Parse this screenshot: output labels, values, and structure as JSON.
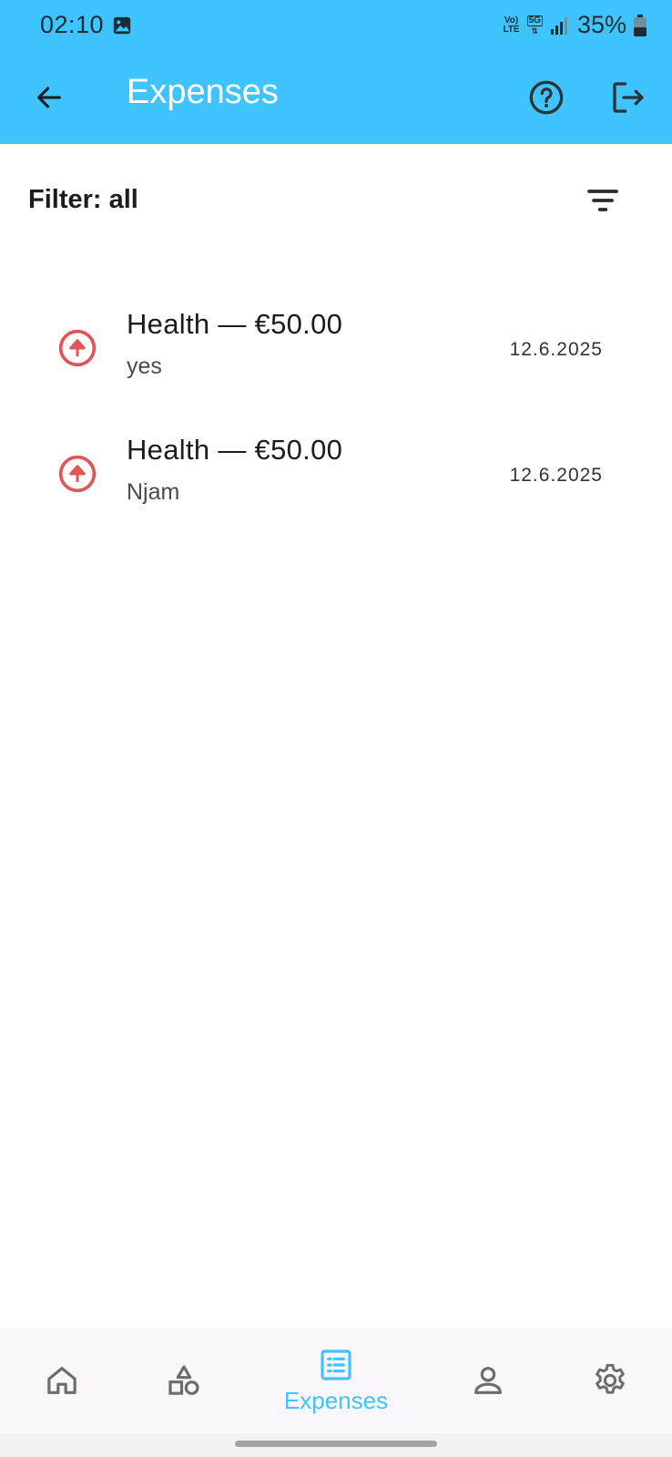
{
  "status_bar": {
    "time": "02:10",
    "network_top": "Vo)",
    "network_bottom": "LTE",
    "network_5g": "5G",
    "battery": "35%",
    "icons": [
      "gallery-icon",
      "signal-icon",
      "battery-icon"
    ]
  },
  "app_bar": {
    "title": "Expenses",
    "icons": [
      "back-arrow-icon",
      "help-icon",
      "logout-icon"
    ],
    "color": "#40c4ff"
  },
  "filter": {
    "label": "Filter: all",
    "icon": "filter-list-icon"
  },
  "expenses": [
    {
      "title": "Health — €50.00",
      "subtitle": "yes",
      "date": "12.6.2025",
      "icon": "arrow-up-circle-icon"
    },
    {
      "title": "Health — €50.00",
      "subtitle": "Njam",
      "date": "12.6.2025",
      "icon": "arrow-up-circle-icon"
    }
  ],
  "bottom_nav": {
    "items": [
      {
        "id": "home",
        "icon": "home-icon",
        "label": ""
      },
      {
        "id": "categories",
        "icon": "shapes-icon",
        "label": ""
      },
      {
        "id": "expenses",
        "icon": "list-icon",
        "label": "Expenses",
        "active": true
      },
      {
        "id": "profile",
        "icon": "person-icon",
        "label": ""
      },
      {
        "id": "settings",
        "icon": "gear-icon",
        "label": ""
      }
    ],
    "active_color": "#40c4ff",
    "inactive_color": "#6b6b70"
  },
  "colors": {
    "expense_icon": "#e05555"
  }
}
